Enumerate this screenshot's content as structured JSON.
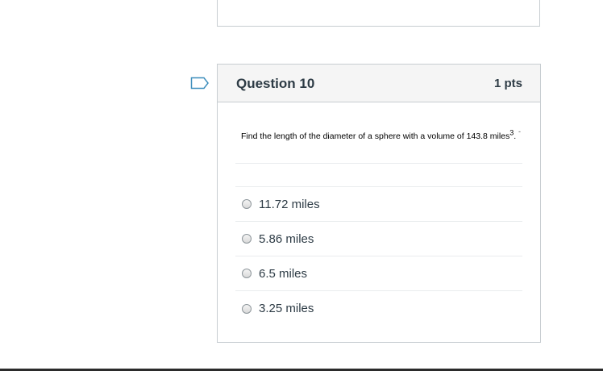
{
  "question": {
    "title": "Question 10",
    "points": "1 pts",
    "text_main": "Find the length of the diameter of a sphere with a volume of 143.8 miles",
    "text_exponent": "3",
    "text_end": ".",
    "tick": "-",
    "flag_icon": "bookmark-flag-icon",
    "answers": [
      {
        "label": "11.72 miles",
        "selected": false
      },
      {
        "label": "5.86 miles",
        "selected": false
      },
      {
        "label": "6.5 miles",
        "selected": false
      },
      {
        "label": "3.25 miles",
        "selected": false
      }
    ]
  },
  "colors": {
    "header_bg": "#f5f5f5",
    "border": "#c7cdd1",
    "flag": "#3c8dbc",
    "text": "#2d3b45"
  }
}
